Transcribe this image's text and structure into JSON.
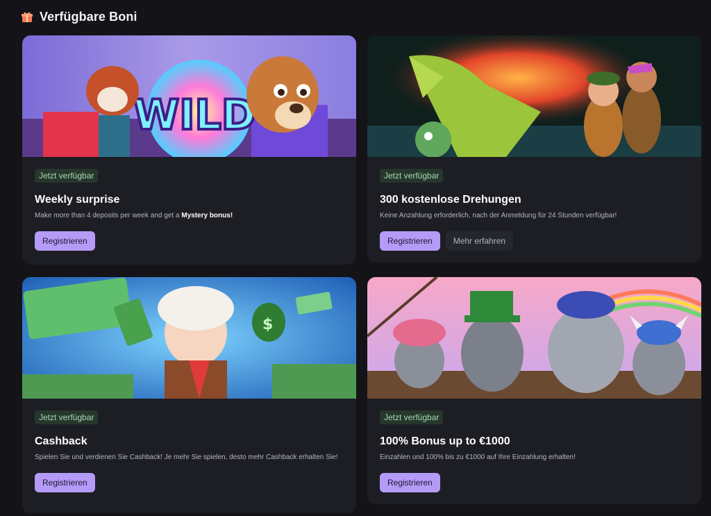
{
  "header": {
    "title": "Verfügbare Boni",
    "icon": "gift-icon"
  },
  "theme": {
    "badge_bg": "#26372c",
    "badge_fg": "#a7d9b4",
    "primary": "#b59bf7",
    "card_bg": "#1d1d24",
    "page_bg": "#131318"
  },
  "bonuses": [
    {
      "badge": "Jetzt verfügbar",
      "title": "Weekly surprise",
      "desc_pre": "Make more than 4 deposits per week and get a ",
      "desc_bold": "Mystery bonus!",
      "primary_label": "Registrieren",
      "banner": "wild-dog-redpanda-banner"
    },
    {
      "badge": "Jetzt verfügbar",
      "title": "300 kostenlose Drehungen",
      "desc": "Keine Anzahlung erforderlich, nach der Anmeldung für 24 Stunden verfügbar!",
      "primary_label": "Registrieren",
      "secondary_label": "Mehr erfahren",
      "banner": "dragon-adventurers-banner"
    },
    {
      "badge": "Jetzt verfügbar",
      "title": "Cashback",
      "desc": "Spielen Sie und verdienen Sie Cashback! Je mehr Sie spielen, desto mehr Cashback erhalten Sie!",
      "primary_label": "Registrieren",
      "banner": "cash-man-banner"
    },
    {
      "badge": "Jetzt verfügbar",
      "title": "100% Bonus up to €1000",
      "desc": "Einzahlen und 100% bis zu €1000 auf Ihre Einzahlung erhalten!",
      "primary_label": "Registrieren",
      "banner": "raccoon-pirates-banner"
    }
  ]
}
